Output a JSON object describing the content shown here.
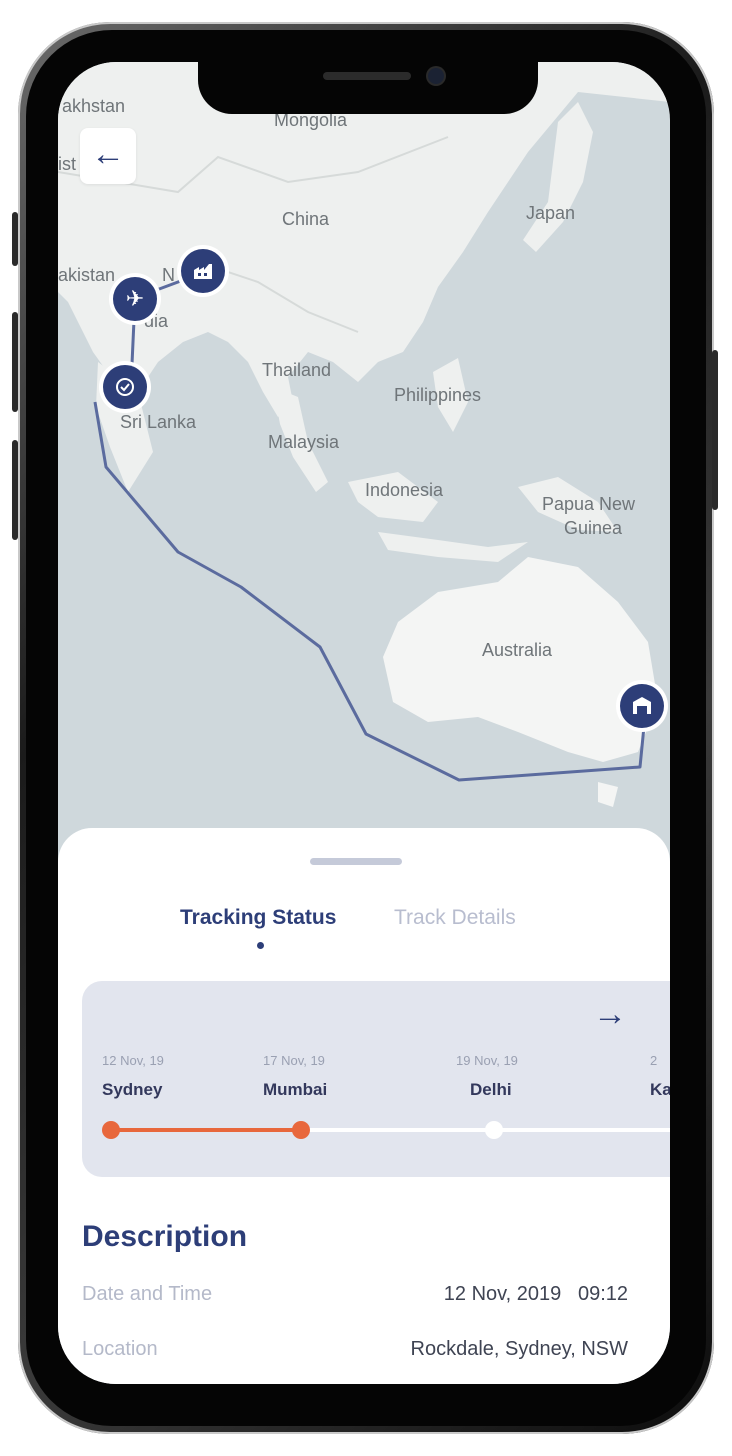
{
  "map": {
    "labels": {
      "kazakhstan": "akhstan",
      "mongolia": "Mongolia",
      "china": "China",
      "japan": "Japan",
      "pakistan": "akistan",
      "nepal": "N",
      "india": "dia",
      "thailand": "Thailand",
      "philippines": "Philippines",
      "sri_lanka": "Sri Lanka",
      "malaysia": "Malaysia",
      "indonesia": "Indonesia",
      "papua_new_guinea_1": "Papua New",
      "papua_new_guinea_2": "Guinea",
      "australia": "Australia",
      "edge_fragment": "ist"
    },
    "back_icon": "arrow-left-icon",
    "pins": [
      "factory-icon",
      "airplane-icon",
      "check-icon",
      "warehouse-icon"
    ],
    "route_color": "#5b6b9e",
    "pin_color": "#2d3e78"
  },
  "sheet": {
    "tabs": [
      {
        "label": "Tracking Status",
        "active": true
      },
      {
        "label": "Track Details",
        "active": false
      }
    ],
    "timeline": {
      "next_icon": "arrow-right-icon",
      "stops": [
        {
          "date": "12 Nov, 19",
          "city": "Sydney",
          "status": "done"
        },
        {
          "date": "17 Nov, 19",
          "city": "Mumbai",
          "status": "current"
        },
        {
          "date": "19 Nov, 19",
          "city": "Delhi",
          "status": "pending"
        },
        {
          "date": "2",
          "city": "Kath",
          "status": "pending"
        }
      ],
      "accent_color": "#e8673c"
    },
    "description": {
      "title": "Description",
      "rows": [
        {
          "label": "Date and Time",
          "value": "12 Nov, 2019   09:12"
        },
        {
          "label": "Location",
          "value": "Rockdale, Sydney, NSW"
        }
      ]
    }
  }
}
